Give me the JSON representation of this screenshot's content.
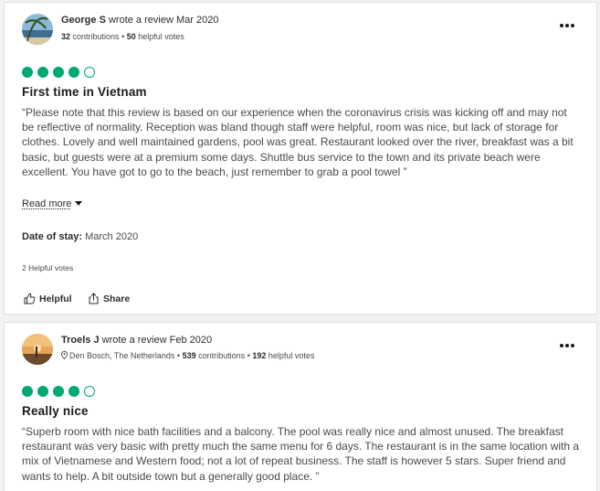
{
  "reviews": [
    {
      "reviewer_name": "George S",
      "action_text": "wrote a review",
      "review_date": "Mar 2020",
      "location": "",
      "contributions": "32",
      "contributions_label": "contributions",
      "helpful_votes_count": "50",
      "helpful_votes_label": "helpful votes",
      "rating": 4,
      "rating_max": 5,
      "title": "First time in Vietnam",
      "text": "“Please note that this review is based on our experience when the coronavirus crisis was kicking off and may not be reflective of normality. Reception was bland though staff were helpful, room was nice, but lack of storage for clothes. Lovely and well maintained gardens, pool was great. Restaurant looked over the river, breakfast was a bit basic, but guests were at a premium some days. Shuttle bus service to the town and its private beach were excellent. You have got to go to the beach, just remember to grab a pool towel ”",
      "read_more": "Read more",
      "date_of_stay_label": "Date of stay:",
      "date_of_stay_value": "March 2020",
      "helpful_votes_summary": "2 Helpful votes",
      "helpful_button": "Helpful",
      "share_button": "Share"
    },
    {
      "reviewer_name": "Troels J",
      "action_text": "wrote a review",
      "review_date": "Feb 2020",
      "location": "Den Bosch, The Netherlands",
      "contributions": "539",
      "contributions_label": "contributions",
      "helpful_votes_count": "192",
      "helpful_votes_label": "helpful votes",
      "rating": 4,
      "rating_max": 5,
      "title": "Really nice",
      "text": "“Superb room with nice bath facilities and a balcony. The pool was really nice and almost unused. The breakfast restaurant was very basic with pretty much the same menu for 6 days. The restaurant is in the same location with a mix of Vietnamese and Western food; not a lot of repeat business. The staff is however 5 stars. Super friend and wants to help. A bit outside town but a generally good place. ”"
    }
  ],
  "colors": {
    "rating_green": "#00aa6c",
    "page_background": "#f2f2f2",
    "card_background": "#ffffff"
  },
  "icons": [
    "avatar-photo",
    "more-options-icon",
    "location-pin-icon",
    "caret-down-icon",
    "thumbs-up-icon",
    "share-icon"
  ]
}
